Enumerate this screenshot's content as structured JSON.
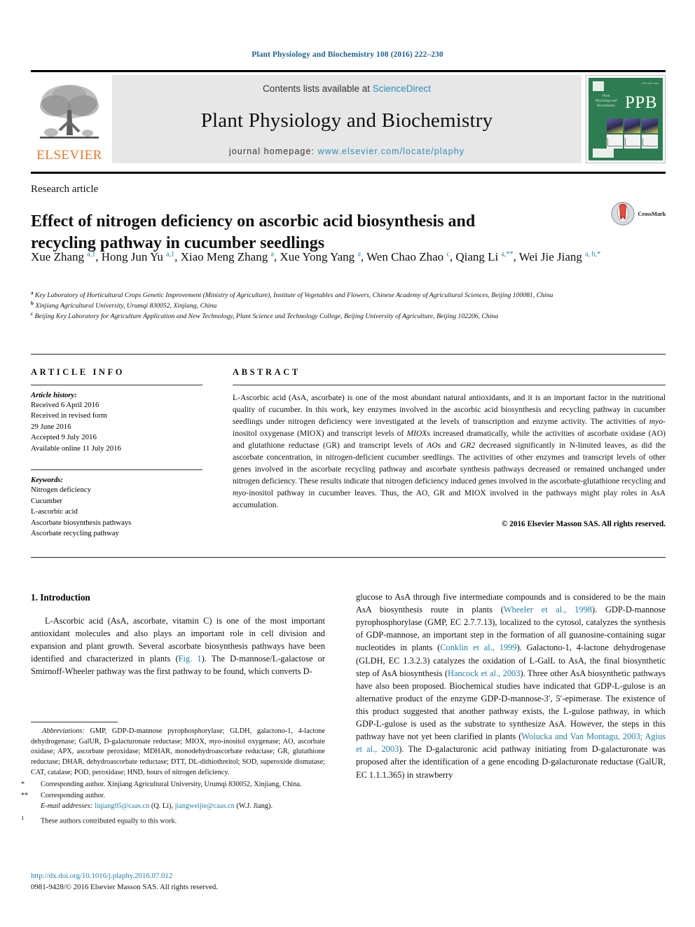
{
  "running_head": "Plant Physiology and Biochemistry 108 (2016) 222–230",
  "masthead": {
    "contents_prefix": "Contents lists available at ",
    "sciencedirect": "ScienceDirect",
    "journal_title": "Plant Physiology and Biochemistry",
    "homepage_prefix": "journal homepage: ",
    "homepage_url": "www.elsevier.com/locate/plaphy",
    "publisher": "ELSEVIER",
    "cover": {
      "abbrev": "PPB",
      "journal_name_small": "Plant Physiology and Biochemistry",
      "issn_small": "ISSN 0981-9428"
    },
    "colors": {
      "link": "#2c8dbe",
      "cover_green": "#2e7d52",
      "elsevier_orange": "#E87722",
      "band_gray": "#e7e7e7"
    }
  },
  "article": {
    "type": "Research article",
    "title": "Effect of nitrogen deficiency on ascorbic acid biosynthesis and recycling pathway in cucumber seedlings",
    "crossmark_label": "CrossMark",
    "authors_html": "Xue Zhang <sup>a,1</sup>, Hong Jun Yu <sup>a,1</sup>, Xiao Meng Zhang <sup>a</sup>, Xue Yong Yang <sup>a</sup>, Wen Chao Zhao <sup>c</sup>, Qiang Li <sup>a,**</sup>, Wei Jie Jiang <sup>a, b,*</sup>",
    "affiliations": [
      {
        "mark": "a",
        "text": "Key Laboratory of Horticultural Crops Genetic Improvement (Ministry of Agriculture), Institute of Vegetables and Flowers, Chinese Academy of Agricultural Sciences, Beijing 100081, China"
      },
      {
        "mark": "b",
        "text": "Xinjiang Agricultural University, Urumqi 830052, Xinjiang, China"
      },
      {
        "mark": "c",
        "text": "Beijing Key Laboratory for Agriculture Application and New Technology, Plant Science and Technology College, Beijing University of Agriculture, Beijing 102206, China"
      }
    ]
  },
  "article_info": {
    "heading": "ARTICLE INFO",
    "history_label": "Article history:",
    "history": [
      "Received 6 April 2016",
      "Received in revised form",
      "29 June 2016",
      "Accepted 9 July 2016",
      "Available online 11 July 2016"
    ],
    "keywords_label": "Keywords:",
    "keywords": [
      "Nitrogen deficiency",
      "Cucumber",
      "L-ascorbic acid",
      "Ascorbate biosynthesis pathways",
      "Ascorbate recycling pathway"
    ]
  },
  "abstract": {
    "heading": "ABSTRACT",
    "body_html": "L-Ascorbic acid (AsA, ascorbate) is one of the most abundant natural antioxidants, and it is an important factor in the nutritional quality of cucumber. In this work, key enzymes involved in the ascorbic acid biosynthesis and recycling pathway in cucumber seedlings under nitrogen deficiency were investigated at the levels of transcription and enzyme activity. The activities of <i>myo</i>-inositol oxygenase (MIOX) and transcript levels of <i>MIOXs</i> increased dramatically, while the activities of ascorbate oxidase (AO) and glutathione reductase (GR) and transcript levels of <i>AOs</i> and <i>GR2</i> decreased significantly in N-limited leaves, as did the ascorbate concentration, in nitrogen-deficient cucumber seedlings. The activities of other enzymes and transcript levels of other genes involved in the ascorbate recycling pathway and ascorbate synthesis pathways decreased or remained unchanged under nitrogen deficiency. These results indicate that nitrogen deficiency induced genes involved in the ascorbate-glutathione recycling and <i>myo</i>-inositol pathway in cucumber leaves. Thus, the AO, GR and MIOX involved in the pathways might play roles in AsA accumulation.",
    "copyright": "© 2016 Elsevier Masson SAS. All rights reserved."
  },
  "body": {
    "section_number_title": "1. Introduction",
    "left_paragraph_html": "L-Ascorbic acid (AsA, ascorbate, vitamin C) is one of the most important antioxidant molecules and also plays an important role in cell division and expansion and plant growth. Several ascorbate biosynthesis pathways have been identified and characterized in plants (<span class=\"ref\">Fig. 1</span>). The D-mannose/L-galactose or Smirnoff-Wheeler pathway was the first pathway to be found, which converts D-",
    "right_paragraph_html": "glucose to AsA through five intermediate compounds and is considered to be the main AsA biosynthesis route in plants (<span class=\"ref\">Wheeler et al., 1998</span>). GDP-D-mannose pyrophosphorylase (GMP, EC 2.7.7.13), localized to the cytosol, catalyzes the synthesis of GDP-mannose, an important step in the formation of all guanosine-containing sugar nucleotides in plants (<span class=\"ref\">Conklin et al., 1999</span>). Galactono-1, 4-lactone dehydrogenase (GLDH, EC 1.3.2.3) catalyzes the oxidation of L-GalL to AsA, the final biosynthetic step of AsA biosynthesis (<span class=\"ref\">Hancock et al., 2003</span>). Three other AsA biosynthetic pathways have also been proposed. Biochemical studies have indicated that GDP-L-gulose is an alternative product of the enzyme GDP-D-mannose-3&#8242;, 5&#8242;-epimerase. The existence of this product suggested that another pathway exists, the L-gulose pathway, in which GDP-L-gulose is used as the substrate to synthesize AsA. However, the steps in this pathway have not yet been clarified in plants (<span class=\"ref\">Wolucka and Van Montagu, 2003; Agius et al., 2003</span>). The D-galacturonic acid pathway initiating from D-galacturonate was proposed after the identification of a gene encoding D-galacturonate reductase (GalUR, EC 1.1.1.365) in strawberry"
  },
  "footnotes": {
    "abbreviations_html": "<i>Abbreviations:</i> GMP, GDP-D-mannose pyrophosphorylase; GLDH, galactono-1, 4-lactone dehydrogenase; GalUR, D-galacturonate reductase; MIOX, <i>myo</i>-inositol oxygenase; AO, ascorbate oxidase; APX, ascorbate peroxidase; MDHAR, monodehydroascorbate reductase; GR, glutathione reductase; DHAR, dehydroascorbate reductase; DTT, DL-dithiothreitol; SOD, superoxide dismutase; CAT, catalase; POD, peroxidase; HND, hours of nitrogen deficiency.",
    "corresponding_1_mark": "*",
    "corresponding_1": "Corresponding author. Xinjiang Agricultural University, Urumqi 830052, Xinjiang, China.",
    "corresponding_2_mark": "**",
    "corresponding_2": "Corresponding author.",
    "email_label": "E-mail addresses:",
    "email_1": "liqiang05@caas.cn",
    "email_1_who": "(Q. Li),",
    "email_2": "jiangweijie@caas.cn",
    "email_2_who": "(W.J. Jiang).",
    "equal_mark": "1",
    "equal_contrib": "These authors contributed equally to this work."
  },
  "footer": {
    "doi": "http://dx.doi.org/10.1016/j.plaphy.2016.07.012",
    "issn_copyright": "0981-9428/© 2016 Elsevier Masson SAS. All rights reserved."
  }
}
